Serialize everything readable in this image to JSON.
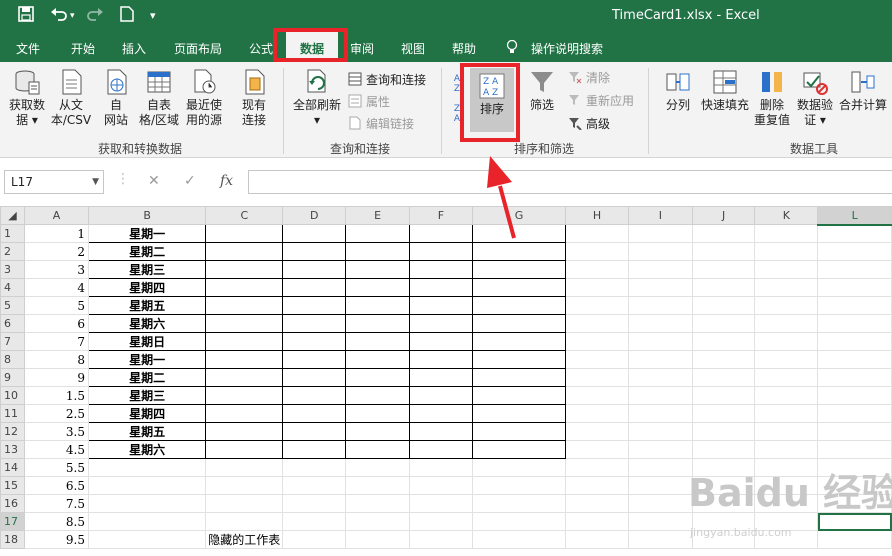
{
  "titlebar": {
    "title": "TimeCard1.xlsx  -  Excel",
    "save_icon": "save-icon",
    "undo_icon": "undo-icon",
    "redo_icon": "redo-icon",
    "new_icon": "new-file-icon",
    "customize_icon": "customize-icon"
  },
  "tabs": {
    "file": "文件",
    "home": "开始",
    "insert": "插入",
    "layout": "页面布局",
    "formulas": "公式",
    "data": "数据",
    "review": "审阅",
    "view": "视图",
    "help": "帮助",
    "tellme": "操作说明搜索"
  },
  "ribbon": {
    "get_data": [
      "获取数",
      "据 ▾"
    ],
    "from_text": [
      "从文",
      "本/CSV"
    ],
    "from_web": [
      "自",
      "网站"
    ],
    "from_table": [
      "自表",
      "格/区域"
    ],
    "recent_sources": [
      "最近使",
      "用的源"
    ],
    "existing_conn": [
      "现有",
      "连接"
    ],
    "group_get": "获取和转换数据",
    "refresh_all": [
      "全部刷新",
      "▾"
    ],
    "queries_conn": "查询和连接",
    "properties": "属性",
    "edit_links": "编辑链接",
    "group_query": "查询和连接",
    "sort": "排序",
    "filter": "筛选",
    "clear": "清除",
    "reapply": "重新应用",
    "advanced": "高级",
    "group_sort": "排序和筛选",
    "split": "分列",
    "flash_fill": "快速填充",
    "remove_dup": [
      "删除",
      "重复值"
    ],
    "validation": [
      "数据验",
      "证 ▾"
    ],
    "consolidate": "合并计算",
    "group_tools": "数据工具"
  },
  "formula_bar": {
    "name_box": "L17",
    "cancel": "✕",
    "enter": "✓",
    "fx": "fx",
    "value": ""
  },
  "sheet": {
    "columns": [
      "A",
      "B",
      "C",
      "D",
      "E",
      "F",
      "G",
      "H",
      "I",
      "J",
      "K",
      "L"
    ],
    "rows": [
      {
        "n": "1",
        "a": "1",
        "b": "星期一"
      },
      {
        "n": "2",
        "a": "2",
        "b": "星期二"
      },
      {
        "n": "3",
        "a": "3",
        "b": "星期三"
      },
      {
        "n": "4",
        "a": "4",
        "b": "星期四"
      },
      {
        "n": "5",
        "a": "5",
        "b": "星期五"
      },
      {
        "n": "6",
        "a": "6",
        "b": "星期六"
      },
      {
        "n": "7",
        "a": "7",
        "b": "星期日"
      },
      {
        "n": "8",
        "a": "8",
        "b": "星期一"
      },
      {
        "n": "9",
        "a": "9",
        "b": "星期二"
      },
      {
        "n": "10",
        "a": "1.5",
        "b": "星期三"
      },
      {
        "n": "11",
        "a": "2.5",
        "b": "星期四"
      },
      {
        "n": "12",
        "a": "3.5",
        "b": "星期五"
      },
      {
        "n": "13",
        "a": "4.5",
        "b": "星期六"
      },
      {
        "n": "14",
        "a": "5.5",
        "b": ""
      },
      {
        "n": "15",
        "a": "6.5",
        "b": ""
      },
      {
        "n": "16",
        "a": "7.5",
        "b": ""
      },
      {
        "n": "17",
        "a": "8.5",
        "b": ""
      },
      {
        "n": "18",
        "a": "9.5",
        "b": ""
      }
    ],
    "note_c18": "隐藏的工作表",
    "selected_cell": "L17"
  },
  "watermark": {
    "main": "Baidu 经验",
    "sub": "jingyan.baidu.com"
  },
  "colors": {
    "accent": "#217346",
    "highlight": "#e8232a"
  }
}
